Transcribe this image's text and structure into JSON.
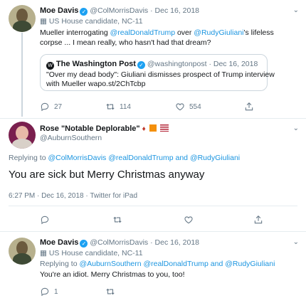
{
  "tweet1": {
    "display_name": "Moe Davis",
    "handle": "@ColMorrisDavis",
    "date": "Dec 16, 2018",
    "label": "US House candidate, NC-11",
    "text_pre": "Mueller interrogating ",
    "mention1": "@realDonaldTrump",
    "text_mid": " over ",
    "mention2": "@RudyGiuliani",
    "text_post": "'s lifeless",
    "line2": "corpse ... I mean really, who hasn't had that dream?",
    "quote": {
      "display_name": "The Washington Post",
      "handle": "@washingtonpost",
      "date": "Dec 16, 2018",
      "line1": "\"Over my dead body\": Giuliani dismisses prospect of Trump interview",
      "line2": "with Mueller wapo.st/2ChTcbp"
    },
    "reply_count": "27",
    "retweet_count": "114",
    "like_count": "554"
  },
  "tweet2": {
    "display_name": "Rose \"Notable Deplorable\"",
    "handle": "@AuburnSouthern",
    "replying_prefix": "Replying to ",
    "replying_targets": "@ColMorrisDavis @realDonaldTrump and @RudyGiuliani",
    "text": "You are sick but Merry Christmas anyway",
    "meta": "6:27 PM · Dec 16, 2018 · Twitter for iPad"
  },
  "tweet3": {
    "display_name": "Moe Davis",
    "handle": "@ColMorrisDavis",
    "date": "Dec 16, 2018",
    "label": "US House candidate, NC-11",
    "replying_prefix": "Replying to ",
    "replying_targets": "@AuburnSouthern @realDonaldTrump and @RudyGiuliani",
    "text": "You're an idiot.  Merry Christmas to you, too!",
    "reply_count": "1"
  },
  "colors": {
    "link": "#1b95e0",
    "muted": "#657786",
    "verified": "#1da1f2"
  }
}
